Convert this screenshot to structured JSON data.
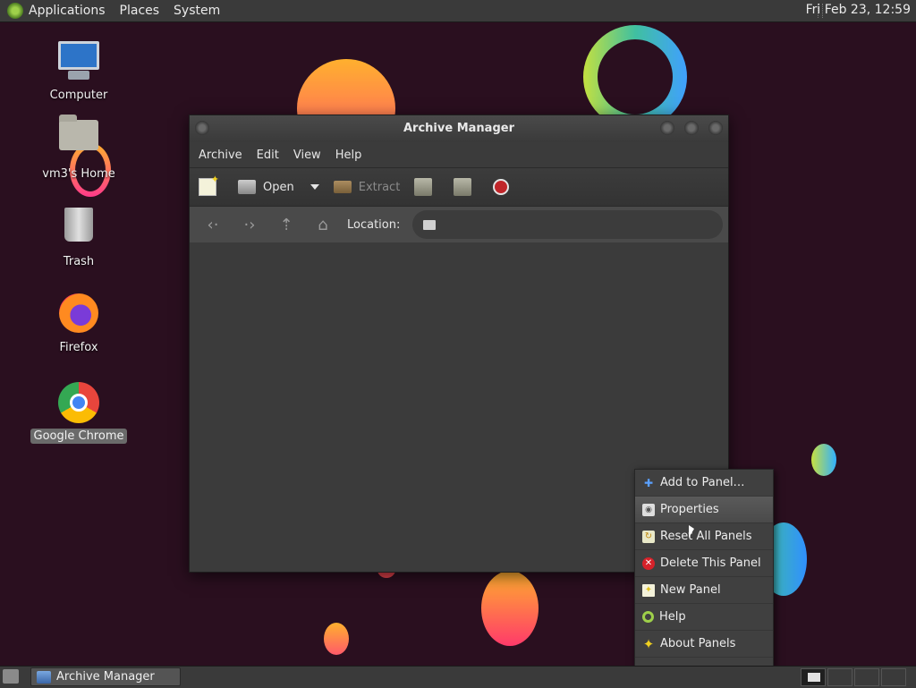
{
  "top_panel": {
    "menus": [
      "Applications",
      "Places",
      "System"
    ],
    "clock": "Fri Feb 23, 12:59"
  },
  "desktop_icons": [
    {
      "label": "Computer",
      "icon": "computer-icon"
    },
    {
      "label": "vm3's Home",
      "icon": "home-folder-icon"
    },
    {
      "label": "Trash",
      "icon": "trash-icon"
    },
    {
      "label": "Firefox",
      "icon": "firefox-icon"
    },
    {
      "label": "Google Chrome",
      "icon": "chrome-icon",
      "selected": true
    }
  ],
  "window": {
    "title": "Archive Manager",
    "menu": [
      "Archive",
      "Edit",
      "View",
      "Help"
    ],
    "toolbar": {
      "open_label": "Open",
      "extract_label": "Extract"
    },
    "location_label": "Location:"
  },
  "context_menu": {
    "items": [
      {
        "label": "Add to Panel…",
        "icon": "plus-icon"
      },
      {
        "label": "Properties",
        "icon": "properties-icon",
        "hover": true
      },
      {
        "label": "Reset All Panels",
        "icon": "reset-icon"
      },
      {
        "label": "Delete This Panel",
        "icon": "delete-icon"
      },
      {
        "label": "New Panel",
        "icon": "new-panel-icon"
      },
      {
        "label": "Help",
        "icon": "help-icon"
      },
      {
        "label": "About Panels",
        "icon": "about-icon"
      }
    ]
  },
  "taskbar": {
    "task_label": "Archive Manager"
  }
}
